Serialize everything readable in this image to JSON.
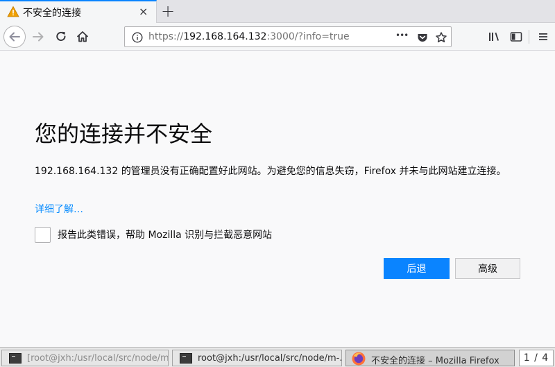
{
  "tab": {
    "title": "不安全的连接",
    "close_label": "×"
  },
  "newtab_label": "+",
  "url": {
    "scheme": "https://",
    "host": "192.168.164.132",
    "rest": ":3000/?info=true",
    "more_label": "•••"
  },
  "page": {
    "heading": "您的连接并不安全",
    "description": "192.168.164.132 的管理员没有正确配置好此网站。为避免您的信息失窃，Firefox 并未与此网站建立连接。",
    "learn_more": "详细了解…",
    "report_label": "报告此类错误，帮助 Mozilla 识别与拦截恶意网站",
    "go_back_label": "后退",
    "advanced_label": "高级"
  },
  "taskbar": {
    "items": [
      {
        "label": "[root@jxh:/usr/local/src/node/m-…"
      },
      {
        "label": "root@jxh:/usr/local/src/node/m-…"
      },
      {
        "label": "不安全的连接 – Mozilla Firefox"
      }
    ],
    "pager": "1 / 4"
  },
  "colors": {
    "accent": "#0a84ff",
    "link": "#0a8dff",
    "warning": "#f0a000"
  },
  "icons": [
    "warning-icon",
    "close-icon",
    "plus-icon",
    "back-icon",
    "forward-icon",
    "reload-icon",
    "home-icon",
    "info-icon",
    "pocket-icon",
    "bookmark-star-icon",
    "library-icon",
    "sidebar-icon",
    "menu-icon",
    "terminal-icon",
    "firefox-icon"
  ]
}
